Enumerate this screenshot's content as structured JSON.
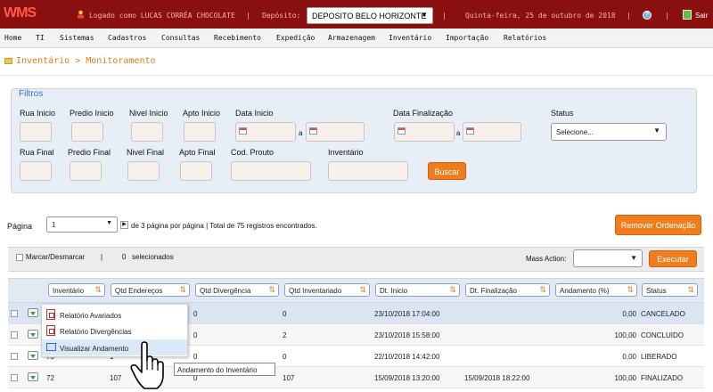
{
  "colors": {
    "topbar": "#8a0f0f",
    "accent": "#f07d1d",
    "filter_title": "#2c74c8",
    "breadcrumb": "#e07b18"
  },
  "topbar": {
    "logo": "WMS",
    "user_text": "Logado como LUCAS CORRÊA CHOCOLATE",
    "separator": "|",
    "deposit_label": "Depósito:",
    "deposit_value": "DEPOSITO BELO HORIZONTE",
    "date_text": "Quinta-feira, 25 de outubro de 2018",
    "help_icon": "help-icon",
    "exit_label": "Sair"
  },
  "menu": [
    "Home",
    "TI",
    "Sistemas",
    "Cadastros",
    "Consultas",
    "Recebimento",
    "Expedição",
    "Armazenagem",
    "Inventário",
    "Importação",
    "Relatórios"
  ],
  "breadcrumb": "Inventário > Monitoramento",
  "filters": {
    "title": "Filtros",
    "rua_inicio": "Rua Inicio",
    "predio_inicio": "Predio Inicio",
    "nivel_inicio": "Nivel Inicio",
    "apto_inicio": "Apto Inicio",
    "data_inicio": "Data Inicio",
    "data_finalizacao": "Data Finalização",
    "status": "Status",
    "status_value": "Selecione...",
    "rua_final": "Rua Final",
    "predio_final": "Predio Final",
    "nivel_final": "Nivel Final",
    "apto_final": "Apto Final",
    "cod_produto": "Cod. Prouto",
    "inventario": "Inventário",
    "a": "a",
    "buscar": "Buscar"
  },
  "pagination": {
    "label": "Página",
    "value": "1",
    "info": "de 3 página por página | Total de 75 registros encontrados."
  },
  "remover_ordenacao": "Remover Ordenação",
  "mass_action": {
    "select_all": "Marcar/Desmarcar",
    "separator": "|",
    "count": "0",
    "selected_label": "selecionados",
    "label": "Mass Action:",
    "execute": "Executar"
  },
  "columns": [
    "Inventário",
    "Qtd Endereços",
    "Qtd Divergência",
    "Qtd Inventariado",
    "Dt. Inicio",
    "Dt. Finalização",
    "Andamento (%)",
    "Status"
  ],
  "rows": [
    {
      "inventario": "",
      "enderecos": "",
      "divergencia": "0",
      "inventariado": "0",
      "inicio": "23/10/2018 17:04:00",
      "finalizacao": "",
      "andamento": "0,00",
      "status": "CANCELADO"
    },
    {
      "inventario": "",
      "enderecos": "",
      "divergencia": "0",
      "inventariado": "2",
      "inicio": "23/10/2018 15:58:00",
      "finalizacao": "",
      "andamento": "100,00",
      "status": "CONCLUIDO"
    },
    {
      "inventario": "73",
      "enderecos": "1",
      "divergencia": "0",
      "inventariado": "0",
      "inicio": "22/10/2018 14:42:00",
      "finalizacao": "",
      "andamento": "0,00",
      "status": "LIBERADO"
    },
    {
      "inventario": "72",
      "enderecos": "107",
      "divergencia": "0",
      "inventariado": "107",
      "inicio": "15/09/2018 13:20:00",
      "finalizacao": "15/09/2018 18:22:00",
      "andamento": "100,00",
      "status": "FINALIZADO"
    }
  ],
  "context_menu": [
    "Relatório Avariados",
    "Relatório Divergências",
    "Visualizar Andamento"
  ],
  "tooltip": "Andamento do Inventário"
}
